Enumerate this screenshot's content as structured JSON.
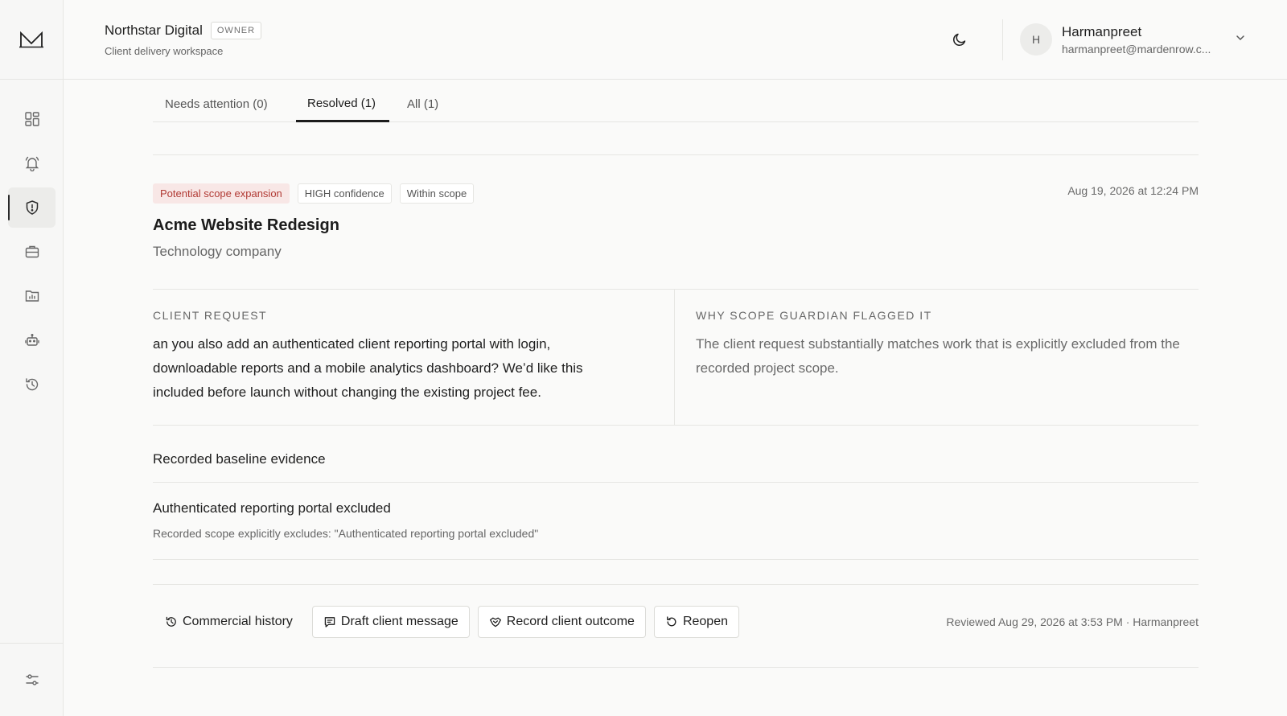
{
  "workspace": {
    "name": "Northstar Digital",
    "role_badge": "OWNER",
    "subtitle": "Client delivery workspace"
  },
  "user": {
    "initial": "H",
    "name": "Harmanpreet",
    "email": "harmanpreet@mardenrow.c..."
  },
  "sidebar": {
    "items": [
      {
        "icon": "dashboard-icon"
      },
      {
        "icon": "bell-icon"
      },
      {
        "icon": "shield-alert-icon",
        "active": true
      },
      {
        "icon": "briefcase-icon"
      },
      {
        "icon": "folder-chart-icon"
      },
      {
        "icon": "robot-icon"
      },
      {
        "icon": "history-icon"
      }
    ],
    "bottom_icon": "sliders-icon"
  },
  "tabs": [
    {
      "label": "Needs attention (0)"
    },
    {
      "label": "Resolved (1)",
      "active": true
    },
    {
      "label": "All (1)"
    }
  ],
  "flag": {
    "badges": [
      "Potential scope expansion",
      "HIGH confidence",
      "Within scope"
    ],
    "timestamp": "Aug 19, 2026 at 12:24 PM",
    "project_title": "Acme Website Redesign",
    "project_subtitle": "Technology company",
    "client_request_label": "CLIENT REQUEST",
    "client_request_text": "an you also add an authenticated client reporting portal with login, downloadable reports and a mobile analytics dashboard? We’d like this included before launch without changing the existing project fee.",
    "why_label": "WHY SCOPE GUARDIAN FLAGGED IT",
    "why_text": "The client request substantially matches work that is explicitly excluded from the recorded project scope.",
    "evidence_heading": "Recorded baseline evidence",
    "evidence_title": "Authenticated reporting portal excluded",
    "evidence_desc": "Recorded scope explicitly excludes: \"Authenticated reporting portal excluded\""
  },
  "actions": {
    "history": "Commercial history",
    "draft": "Draft client message",
    "record": "Record client outcome",
    "reopen": "Reopen",
    "review_note": "Reviewed Aug 29, 2026 at 3:53 PM · Harmanpreet"
  }
}
